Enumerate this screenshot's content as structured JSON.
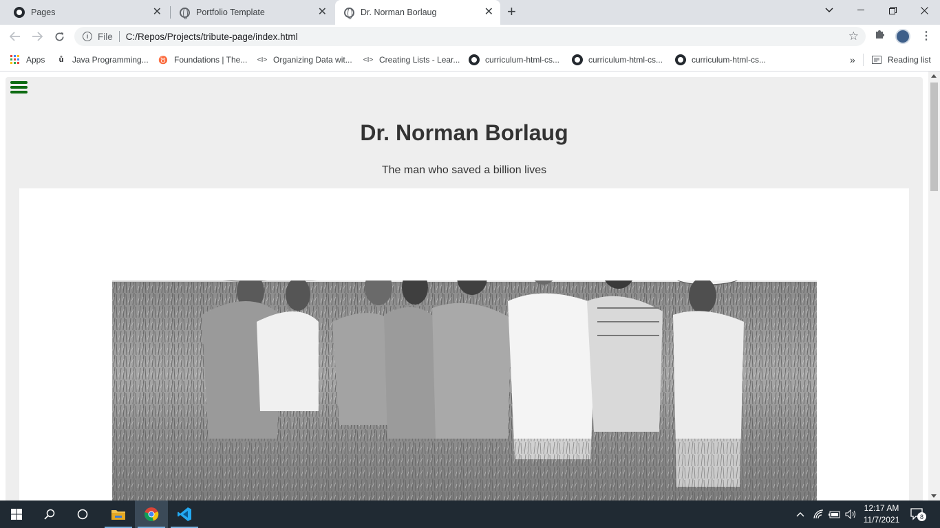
{
  "browser": {
    "tabs": [
      {
        "title": "Pages",
        "icon": "github-icon"
      },
      {
        "title": "Portfolio Template",
        "icon": "globe-icon"
      },
      {
        "title": "Dr. Norman Borlaug",
        "icon": "globe-icon",
        "active": true
      }
    ],
    "address": {
      "scheme": "File",
      "url": "C:/Repos/Projects/tribute-page/index.html"
    },
    "bookmarks": [
      {
        "label": "Apps",
        "icon": "apps-grid-icon"
      },
      {
        "label": "Java Programming...",
        "icon": "java-icon"
      },
      {
        "label": "Foundations | The...",
        "icon": "odin-icon"
      },
      {
        "label": "Organizing Data wit...",
        "icon": "code-icon"
      },
      {
        "label": "Creating Lists - Lear...",
        "icon": "code-icon"
      },
      {
        "label": "curriculum-html-cs...",
        "icon": "github-icon"
      },
      {
        "label": "curriculum-html-cs...",
        "icon": "github-icon"
      },
      {
        "label": "curriculum-html-cs...",
        "icon": "github-icon"
      }
    ],
    "overflow_label": "»",
    "reading_list": "Reading list"
  },
  "page": {
    "title": "Dr. Norman Borlaug",
    "subtitle": "The man who saved a billion lives",
    "accent_color": "#0d6b12"
  },
  "taskbar": {
    "time": "12:17 AM",
    "date": "11/7/2021",
    "notifications": "8"
  }
}
